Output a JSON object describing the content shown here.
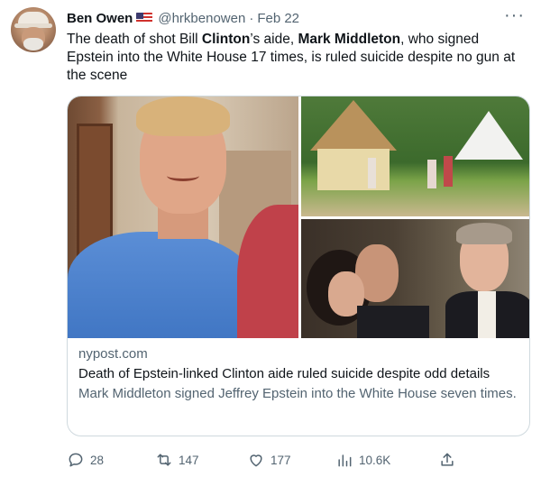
{
  "author": {
    "name": "Ben Owen",
    "handle": "@hrkbenowen",
    "separator": "·",
    "date": "Feb 22",
    "flag_icon": "us-flag-icon"
  },
  "more_icon": "···",
  "tweet": {
    "part1": "The death of shot Bill ",
    "bold1": "Clinton",
    "part2": "’s aide, ",
    "bold2": "Mark Middleton",
    "part3": ", who signed Epstein into the White House 17 times, is ruled suicide despite no gun at the scene"
  },
  "card": {
    "domain": "nypost.com",
    "title": "Death of Epstein-linked Clinton aide ruled suicide despite odd details",
    "description": "Mark Middleton signed Jeffrey Epstein into the White House seven times."
  },
  "actions": {
    "replies": "28",
    "retweets": "147",
    "likes": "177",
    "views": "10.6K"
  },
  "colors": {
    "text": "#0f1419",
    "secondary": "#536471",
    "border": "#cfd9de"
  }
}
